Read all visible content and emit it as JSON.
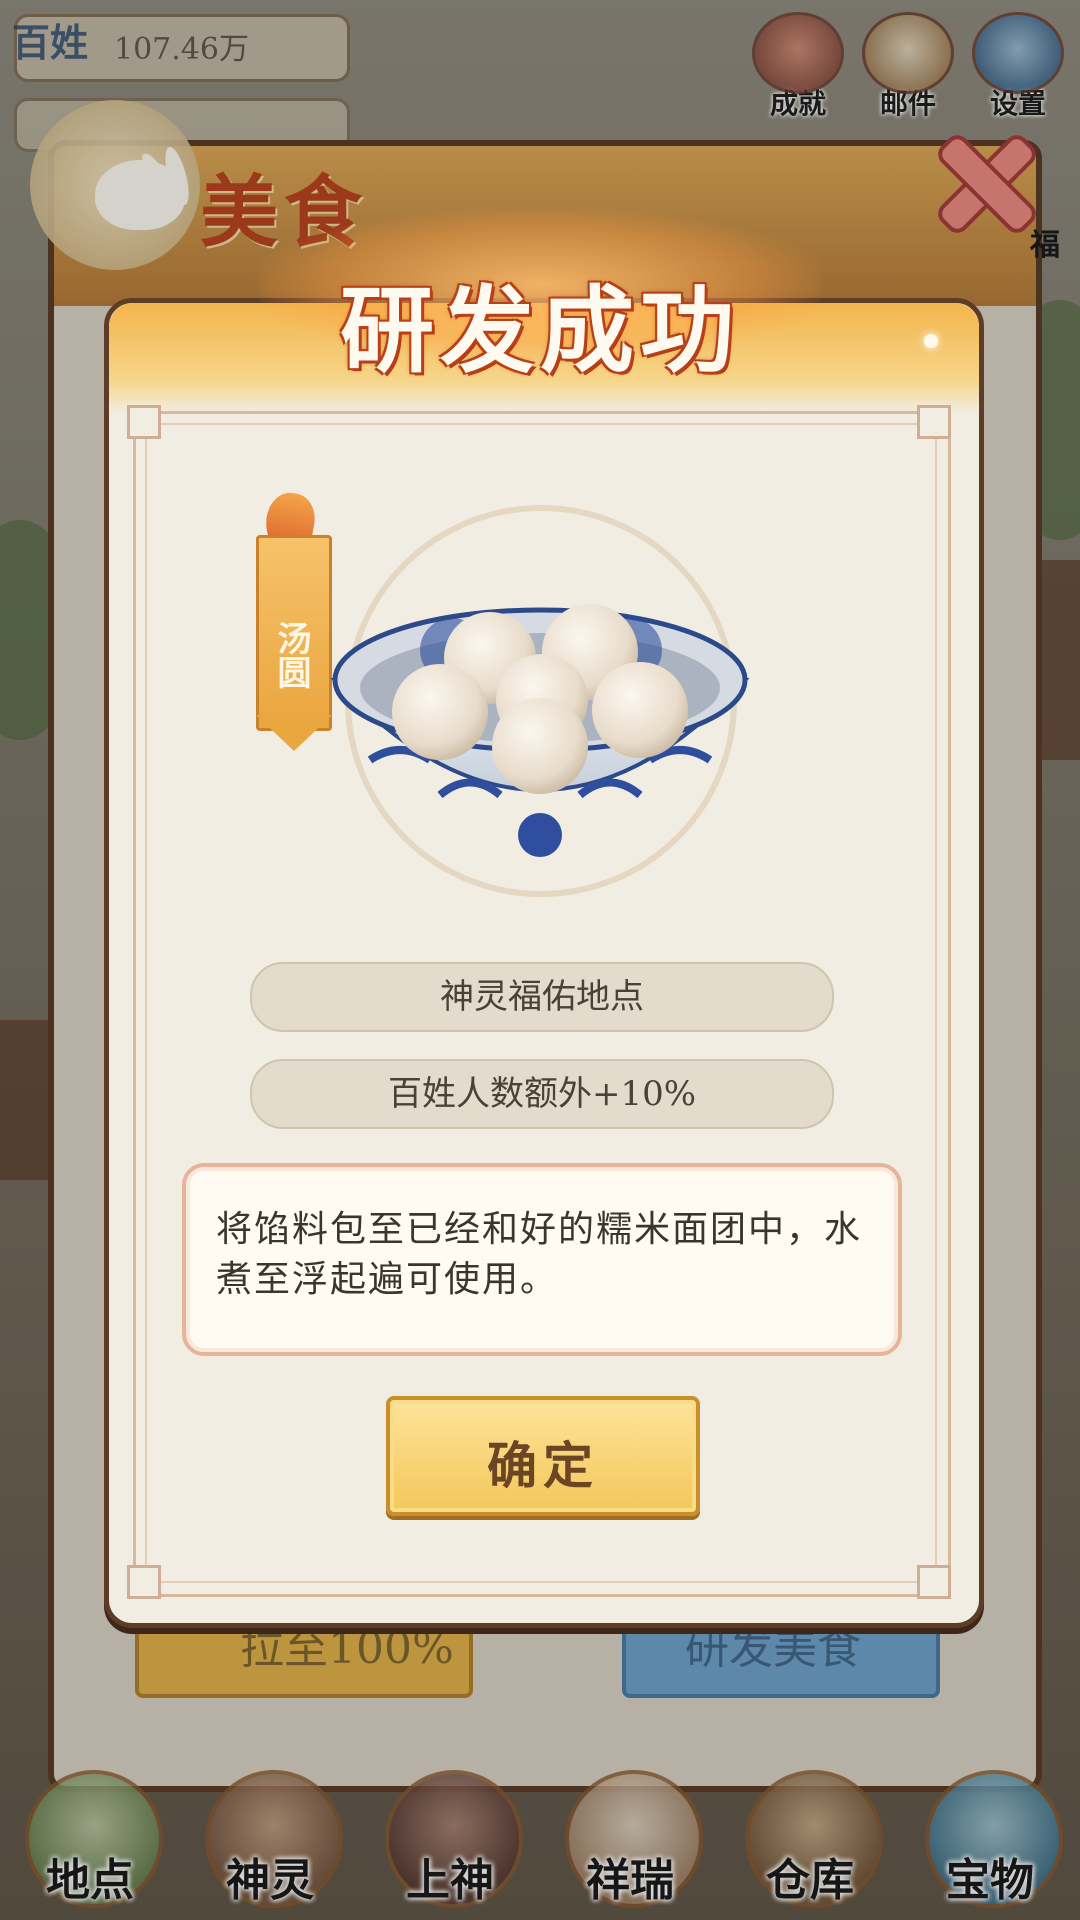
{
  "hud": {
    "resource_label": "百姓",
    "resource_value": "107.46万",
    "top_buttons": [
      {
        "label": "成就",
        "icon": "achievement-scroll-icon"
      },
      {
        "label": "邮件",
        "icon": "mail-letter-icon"
      },
      {
        "label": "设置",
        "icon": "gear-icon"
      }
    ],
    "side_label": "福"
  },
  "food_panel": {
    "title": "美食",
    "button_left_label": "拉至100%",
    "button_right_label": "研发美食"
  },
  "modal": {
    "title": "研发成功",
    "food_name": "汤圆",
    "effect_target": "神灵福佑地点",
    "effect_value": "百姓人数额外+10%",
    "description": "将馅料包至已经和好的糯米面团中，水煮至浮起遍可使用。",
    "confirm_label": "确定"
  },
  "bottom_nav": [
    {
      "label": "地点"
    },
    {
      "label": "神灵"
    },
    {
      "label": "上神"
    },
    {
      "label": "祥瑞"
    },
    {
      "label": "仓库"
    },
    {
      "label": "宝物"
    }
  ],
  "colors": {
    "modal_bg": "#f1ede3",
    "title_text": "#fffaf0",
    "accent_orange": "#f3b54c",
    "confirm_button": "#f4c75a"
  }
}
